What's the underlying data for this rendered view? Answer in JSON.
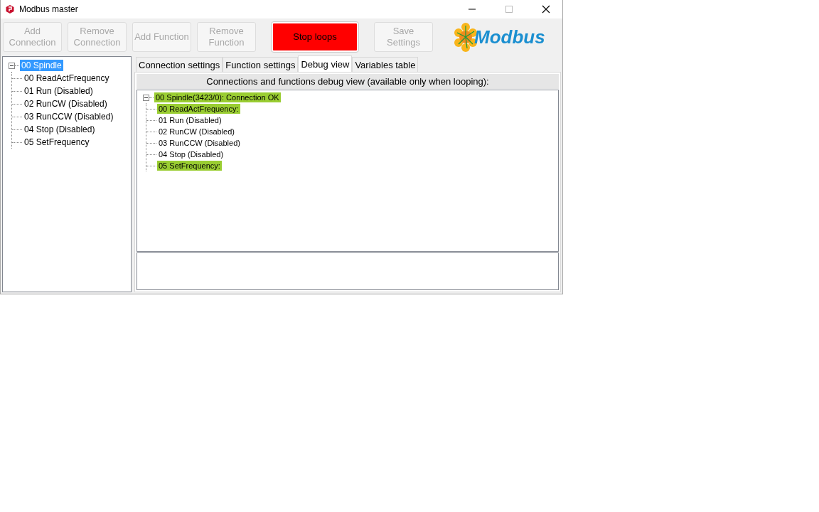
{
  "window": {
    "title": "Modbus master"
  },
  "toolbar": [
    {
      "label": "Add Connection",
      "kind": "normal",
      "disabled": true
    },
    {
      "label": "Remove Connection",
      "kind": "normal",
      "disabled": true
    },
    {
      "label": "Add Function",
      "kind": "normal",
      "disabled": true
    },
    {
      "label": "Remove Function",
      "kind": "normal",
      "disabled": true
    },
    {
      "label": "Stop loops",
      "kind": "alert",
      "disabled": false
    },
    {
      "label": "Save Settings",
      "kind": "normal",
      "disabled": true
    }
  ],
  "logo": {
    "text": "Modbus"
  },
  "connection_tree": [
    {
      "label": "00 Spindle",
      "selected": true,
      "expanded": true,
      "children": [
        {
          "label": "00 ReadActFrequency",
          "selected": false
        },
        {
          "label": "01 Run (Disabled)",
          "selected": false
        },
        {
          "label": "02 RunCW (Disabled)",
          "selected": false
        },
        {
          "label": "03 RunCCW (Disabled)",
          "selected": false
        },
        {
          "label": "04 Stop (Disabled)",
          "selected": false
        },
        {
          "label": "05 SetFrequency",
          "selected": false
        }
      ]
    }
  ],
  "tabs": [
    {
      "label": "Connection settings",
      "selected": false
    },
    {
      "label": "Function settings",
      "selected": false
    },
    {
      "label": "Debug view",
      "selected": true
    },
    {
      "label": "Variables table",
      "selected": false
    }
  ],
  "debug": {
    "header": "Connections and functions debug view (available only when looping):",
    "tree": [
      {
        "label": "00 Spindle(3423/0): Connection OK",
        "highlighted": true,
        "expanded": true,
        "children": [
          {
            "label": "00 ReadActFrequency:",
            "highlighted": true
          },
          {
            "label": "01 Run (Disabled)",
            "highlighted": false
          },
          {
            "label": "02 RunCW (Disabled)",
            "highlighted": false
          },
          {
            "label": "03 RunCCW (Disabled)",
            "highlighted": false
          },
          {
            "label": "04 Stop (Disabled)",
            "highlighted": false
          },
          {
            "label": "05 SetFrequency:",
            "highlighted": true
          }
        ]
      }
    ]
  }
}
